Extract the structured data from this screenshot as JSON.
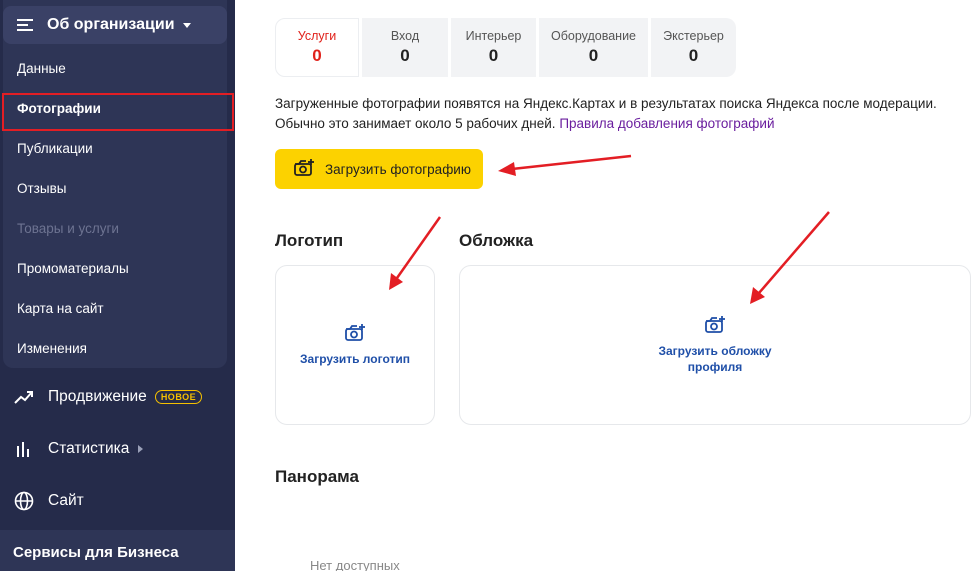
{
  "sidebar": {
    "org_title": "Об организации",
    "org_items": [
      {
        "label": "Данные",
        "state": "normal"
      },
      {
        "label": "Фотографии",
        "state": "active"
      },
      {
        "label": "Публикации",
        "state": "normal"
      },
      {
        "label": "Отзывы",
        "state": "normal"
      },
      {
        "label": "Товары и услуги",
        "state": "disabled"
      },
      {
        "label": "Промоматериалы",
        "state": "normal"
      },
      {
        "label": "Карта на сайт",
        "state": "normal"
      },
      {
        "label": "Изменения",
        "state": "normal"
      }
    ],
    "nav": {
      "promotion": {
        "label": "Продвижение",
        "badge": "НОВОЕ",
        "icon": "trend-icon"
      },
      "stats": {
        "label": "Статистика",
        "icon": "bar-chart-icon"
      },
      "site": {
        "label": "Сайт",
        "icon": "globe-icon"
      }
    },
    "services_label": "Сервисы для Бизнеса"
  },
  "tabs": [
    {
      "label": "Услуги",
      "count": "0",
      "active": true
    },
    {
      "label": "Вход",
      "count": "0",
      "active": false
    },
    {
      "label": "Интерьер",
      "count": "0",
      "active": false
    },
    {
      "label": "Оборудование",
      "count": "0",
      "active": false
    },
    {
      "label": "Экстерьер",
      "count": "0",
      "active": false
    }
  ],
  "info": {
    "line1": "Загруженные фотографии появятся на Яндекс.Картах и в результатах поиска Яндекса после модерации.",
    "line2": "Обычно это занимает около 5 рабочих дней.",
    "link": "Правила добавления фотографий"
  },
  "upload_button": "Загрузить фотографию",
  "logo": {
    "title": "Логотип",
    "action": "Загрузить логотип"
  },
  "cover": {
    "title": "Обложка",
    "action_line1": "Загрузить обложку",
    "action_line2": "профиля"
  },
  "panorama": {
    "title": "Панорама",
    "empty": "Нет доступных"
  },
  "colors": {
    "sidebar": "#252b4a",
    "accent": "#fcd200",
    "active_tab": "#e0221b",
    "link": "#6a1e9e",
    "annotation": "#e31e24"
  }
}
